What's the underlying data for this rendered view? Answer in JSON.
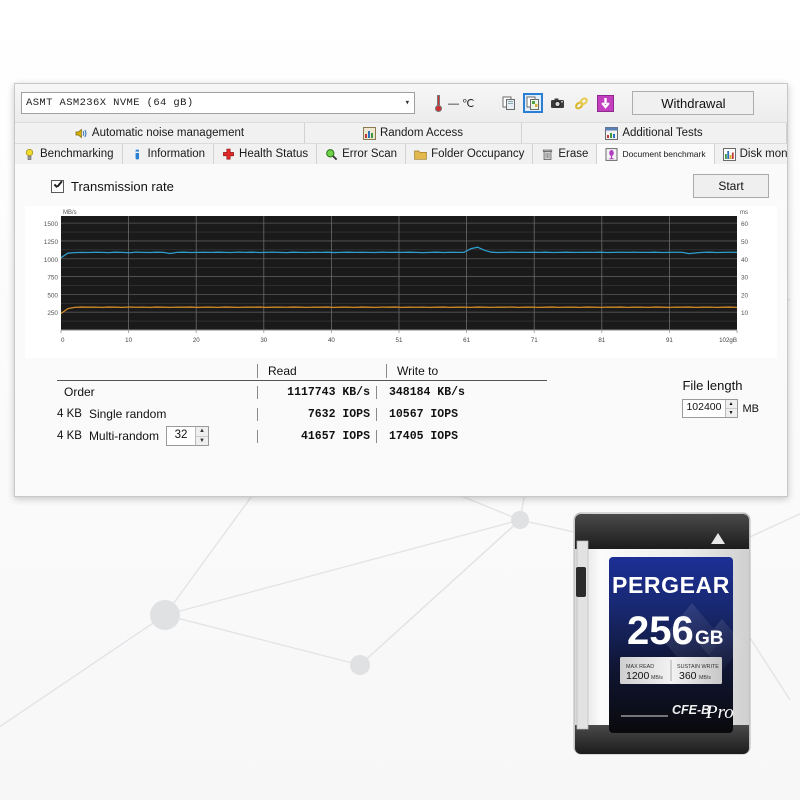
{
  "toolbar": {
    "device_combo": "ASMT    ASM236X NVME (64 gB)",
    "chevron": "chevron-down-icon",
    "temperature": "—  ℃",
    "withdrawal_label": "Withdrawal",
    "buttons": [
      "copy-icon",
      "copy-selected-icon",
      "camera-icon",
      "link-icon",
      "download-icon"
    ]
  },
  "tabs_row1": [
    {
      "label": "Automatic noise management",
      "icon": "speaker-icon"
    },
    {
      "label": "Random Access",
      "icon": "random-access-icon"
    },
    {
      "label": "Additional Tests",
      "icon": "chart-icon"
    }
  ],
  "tabs_row2": [
    {
      "label": "Benchmarking",
      "icon": "bulb-icon"
    },
    {
      "label": "Information",
      "icon": "info-icon"
    },
    {
      "label": "Health Status",
      "icon": "cross-icon"
    },
    {
      "label": "Error Scan",
      "icon": "magnifier-icon"
    },
    {
      "label": "Folder Occupancy",
      "icon": "folder-icon"
    },
    {
      "label": "Erase",
      "icon": "trash-icon"
    },
    {
      "label": "Document benchmark",
      "icon": "document-benchmark-icon"
    },
    {
      "label": "Disk monitors",
      "icon": "bars-icon"
    }
  ],
  "panel": {
    "checkbox_label": "Transmission rate",
    "start_label": "Start"
  },
  "chart_data": {
    "type": "line",
    "title": "",
    "xlabel": "",
    "ylabel": "MB/s",
    "y2label": "ms",
    "xtick_labels": [
      "0",
      "10",
      "20",
      "30",
      "40",
      "51",
      "61",
      "71",
      "81",
      "91",
      "102gB"
    ],
    "ytick_labels": [
      "1500",
      "1250",
      "1000",
      "750",
      "500",
      "250"
    ],
    "y2tick_labels": [
      "60",
      "50",
      "40",
      "30",
      "20",
      "10"
    ],
    "ylim": [
      0,
      1600
    ],
    "y2lim": [
      0,
      64
    ],
    "grid": true,
    "background": "#1a1a1a",
    "series": [
      {
        "name": "read",
        "color": "#2e9ccc",
        "unit": "MB/s",
        "average": 1090,
        "values": [
          1015,
          1078,
          1086,
          1090,
          1088,
          1091,
          1090,
          1086,
          1092,
          1090,
          1084,
          1093,
          1090,
          1088,
          1092,
          1090,
          1074,
          1090,
          1092,
          1088,
          1090,
          1091,
          1089,
          1092,
          1090,
          1088,
          1093,
          1090,
          1092,
          1088,
          1090,
          1093,
          1089,
          1086,
          1092,
          1090,
          1088,
          1091,
          1090,
          1092,
          1087,
          1090,
          1092,
          1089,
          1091,
          1090,
          1088,
          1092,
          1090,
          1091,
          1089,
          1092,
          1090,
          1086,
          1090,
          1092,
          1088,
          1091,
          1090,
          1089,
          1140,
          1162,
          1120,
          1092,
          1088,
          1090,
          1092,
          1090,
          1089,
          1091,
          1090,
          1092,
          1088,
          1090,
          1092,
          1090,
          1089,
          1091,
          1090,
          1092,
          1088,
          1090,
          1091,
          1090,
          1092,
          1089,
          1090,
          1092,
          1088,
          1090,
          1091,
          1090,
          1072,
          1082,
          1090,
          1092,
          1088,
          1090,
          1091,
          1090
        ]
      },
      {
        "name": "write",
        "color": "#d08a28",
        "unit": "MB/s",
        "average": 320,
        "values": [
          232,
          300,
          318,
          322,
          320,
          321,
          318,
          322,
          320,
          318,
          322,
          319,
          321,
          318,
          322,
          320,
          318,
          321,
          320,
          322,
          318,
          320,
          321,
          318,
          322,
          320,
          318,
          321,
          320,
          322,
          318,
          320,
          321,
          319,
          322,
          320,
          318,
          321,
          320,
          322,
          318,
          320,
          321,
          318,
          322,
          320,
          318,
          321,
          320,
          322,
          318,
          320,
          319,
          321,
          318,
          320,
          322,
          318,
          320,
          321,
          318,
          322,
          320,
          318,
          321,
          320,
          322,
          318,
          320,
          321,
          318,
          320,
          322,
          318,
          321,
          320,
          318,
          322,
          320,
          318,
          321,
          320,
          322,
          318,
          320,
          321,
          318,
          322,
          320,
          318,
          321,
          320,
          322,
          318,
          320,
          321,
          318,
          320,
          322,
          318
        ]
      }
    ]
  },
  "results": {
    "col_read": "Read",
    "col_write": "Write to",
    "rows": [
      {
        "label": "Order",
        "size": "",
        "read": "1117743 KB/s",
        "write": "348184 KB/s",
        "spinner": null
      },
      {
        "label": "Single random",
        "size": "4 KB",
        "read": "7632 IOPS",
        "write": "10567 IOPS",
        "spinner": null
      },
      {
        "label": "Multi-random",
        "size": "4 KB",
        "read": "41657 IOPS",
        "write": "17405 IOPS",
        "spinner": "32"
      }
    ]
  },
  "file_length": {
    "title": "File length",
    "value": "102400",
    "unit": "MB"
  },
  "memory_card": {
    "brand": "PERGEAR",
    "capacity_number": "256",
    "capacity_unit": "GB",
    "max_read_label": "MAX READ",
    "max_read_value": "1200",
    "max_read_unit": "MB/s",
    "sustain_write_label": "SUSTAIN WRITE",
    "sustain_write_value": "360",
    "sustain_write_unit": "MB/s",
    "format": "CFE-B",
    "tier": "Pro"
  },
  "colors": {
    "read_line": "#2e9ccc",
    "write_line": "#d08a28",
    "chart_bg": "#1a1a1a",
    "accent_blue": "#2a7fd4",
    "card_blue": "#1b2f8a"
  }
}
